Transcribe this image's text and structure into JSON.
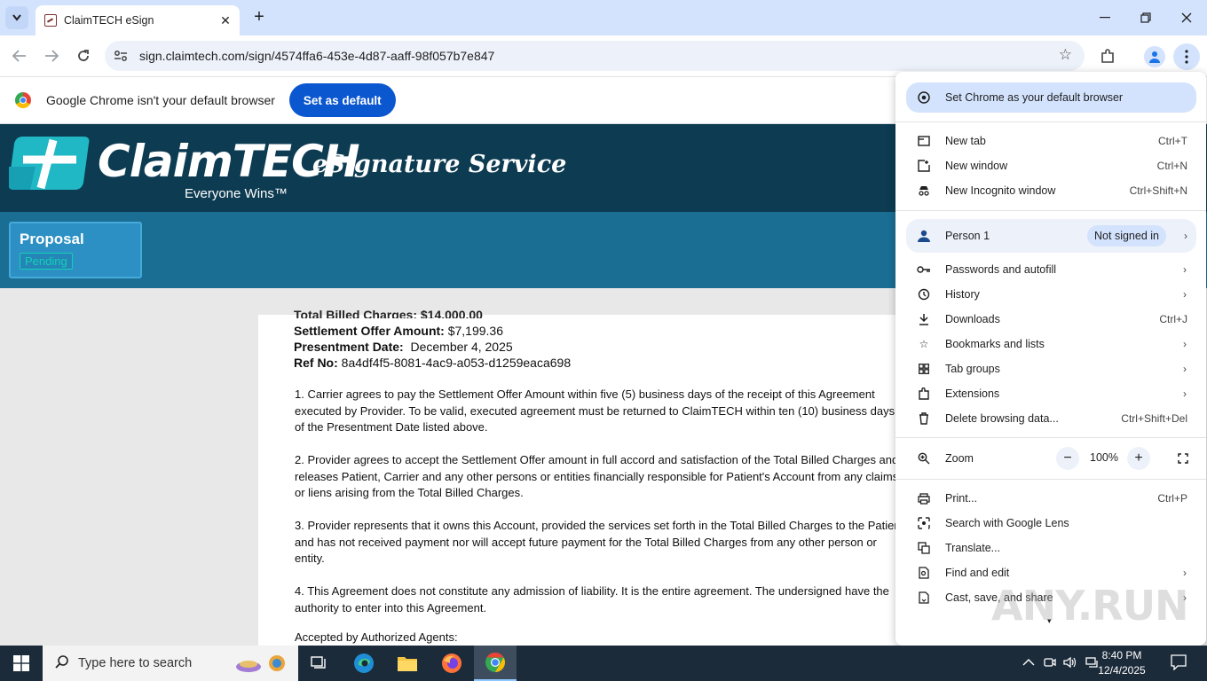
{
  "browser": {
    "tab_title": "ClaimTECH eSign",
    "url": "sign.claimtech.com/sign/4574ffa6-453e-4d87-aaff-98f057b7e847"
  },
  "infobar": {
    "message": "Google Chrome isn't your default browser",
    "button": "Set as default"
  },
  "site": {
    "logo_text": "ClaimTECH",
    "logo_tagline": "Everyone Wins™",
    "service_title": "eSignature Service",
    "status_card": {
      "title": "Proposal",
      "badge": "Pending"
    }
  },
  "document": {
    "cut_line": "Total Billed Charges: $14,000.00",
    "settlement_label": "Settlement Offer Amount:",
    "settlement_value": "$7,199.36",
    "presentment_label": "Presentment Date:",
    "presentment_value": "December 4, 2025",
    "ref_label": "Ref No:",
    "ref_value": "8a4df4f5-8081-4ac9-a053-d1259eaca698",
    "p1": [
      "1. Carrier agrees to pay the Settlement Offer Amount within five (5) business days of the receipt of this Agreement",
      "executed by Provider. To be valid, executed agreement must be returned to ClaimTECH within ten (10) business days",
      "of the Presentment Date listed above."
    ],
    "p2": [
      "2. Provider agrees to accept the Settlement Offer amount in full accord and satisfaction of the Total Billed Charges and",
      "releases Patient, Carrier and any other persons or entities financially responsible for Patient's Account from any claims",
      "or liens arising from the Total Billed Charges."
    ],
    "p3": [
      "3. Provider represents that it owns this Account, provided the services set forth in the Total Billed Charges to the Patient,",
      "and has not received payment nor will accept future payment for the Total Billed Charges from any other person or",
      "entity."
    ],
    "p4": [
      "4. This Agreement does not constitute any admission of liability. It is the entire agreement. The undersigned have the",
      "authority to enter into this Agreement."
    ],
    "accepted": "Accepted by Authorized Agents:"
  },
  "menu": {
    "default_row": "Set Chrome as your default browser",
    "new_tab": {
      "label": "New tab",
      "shortcut": "Ctrl+T"
    },
    "new_window": {
      "label": "New window",
      "shortcut": "Ctrl+N"
    },
    "incognito": {
      "label": "New Incognito window",
      "shortcut": "Ctrl+Shift+N"
    },
    "person": {
      "label": "Person 1",
      "status": "Not signed in"
    },
    "passwords": "Passwords and autofill",
    "history": "History",
    "downloads": {
      "label": "Downloads",
      "shortcut": "Ctrl+J"
    },
    "bookmarks": "Bookmarks and lists",
    "tab_groups": "Tab groups",
    "extensions": "Extensions",
    "delete_data": {
      "label": "Delete browsing data...",
      "shortcut": "Ctrl+Shift+Del"
    },
    "zoom": {
      "label": "Zoom",
      "value": "100%",
      "minus": "−",
      "plus": "+"
    },
    "print": {
      "label": "Print...",
      "shortcut": "Ctrl+P"
    },
    "lens": "Search with Google Lens",
    "translate": "Translate...",
    "find_edit": "Find and edit",
    "cast": "Cast, save, and share",
    "watermark": "ANY.RUN"
  },
  "taskbar": {
    "search_placeholder": "Type here to search",
    "time": "8:40 PM",
    "date": "12/4/2025"
  },
  "colors": {
    "banner": "#0d3b52",
    "status_bar": "#1a6e94",
    "accent": "#0b57d0"
  }
}
